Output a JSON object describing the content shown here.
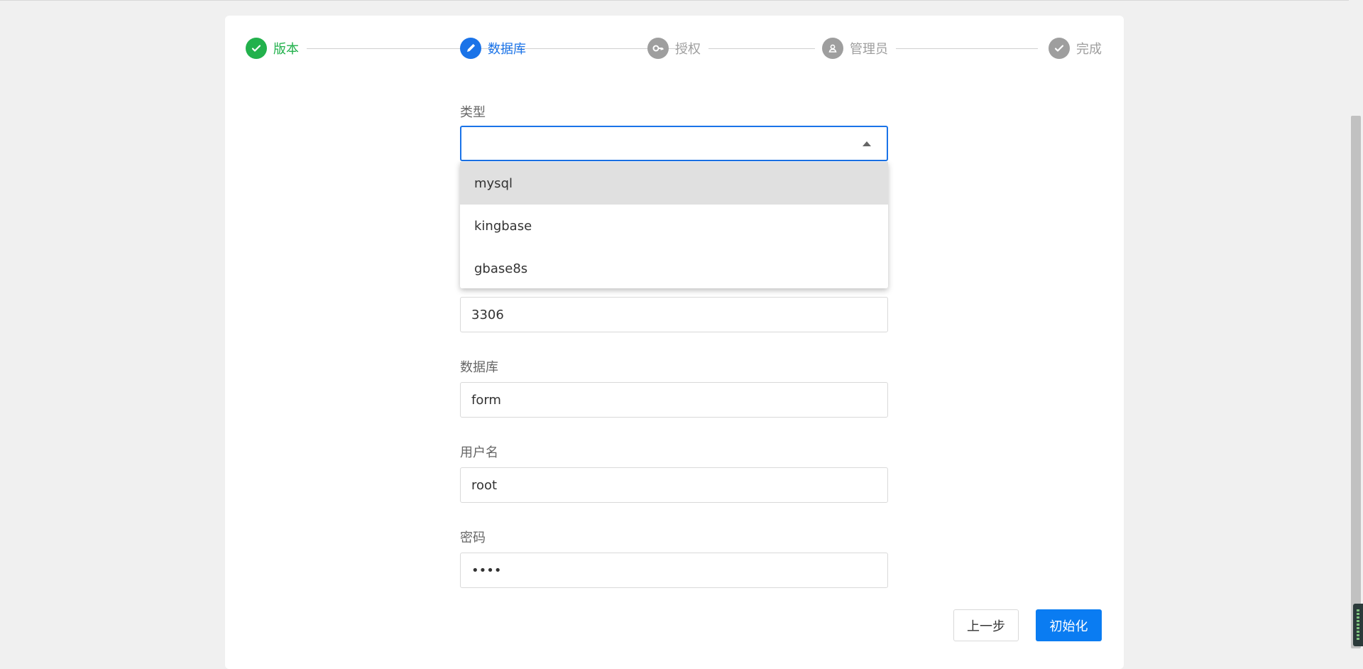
{
  "steps": [
    {
      "label": "版本",
      "state": "done",
      "icon": "check-icon"
    },
    {
      "label": "数据库",
      "state": "active",
      "icon": "pencil-icon"
    },
    {
      "label": "授权",
      "state": "pending",
      "icon": "key-icon"
    },
    {
      "label": "管理员",
      "state": "pending",
      "icon": "user-icon"
    },
    {
      "label": "完成",
      "state": "pending",
      "icon": "check-icon"
    }
  ],
  "form": {
    "type": {
      "label": "类型",
      "value": ""
    },
    "type_options": [
      "mysql",
      "kingbase",
      "gbase8s"
    ],
    "port": {
      "value": "3306"
    },
    "database": {
      "label": "数据库",
      "value": "form"
    },
    "username": {
      "label": "用户名",
      "value": "root"
    },
    "password": {
      "label": "密码",
      "value": "••••"
    }
  },
  "buttons": {
    "prev": "上一步",
    "init": "初始化"
  },
  "colors": {
    "done": "#22b14c",
    "active": "#1a73e8",
    "pending": "#9e9e9e",
    "primary_button": "#0a7cf2"
  }
}
